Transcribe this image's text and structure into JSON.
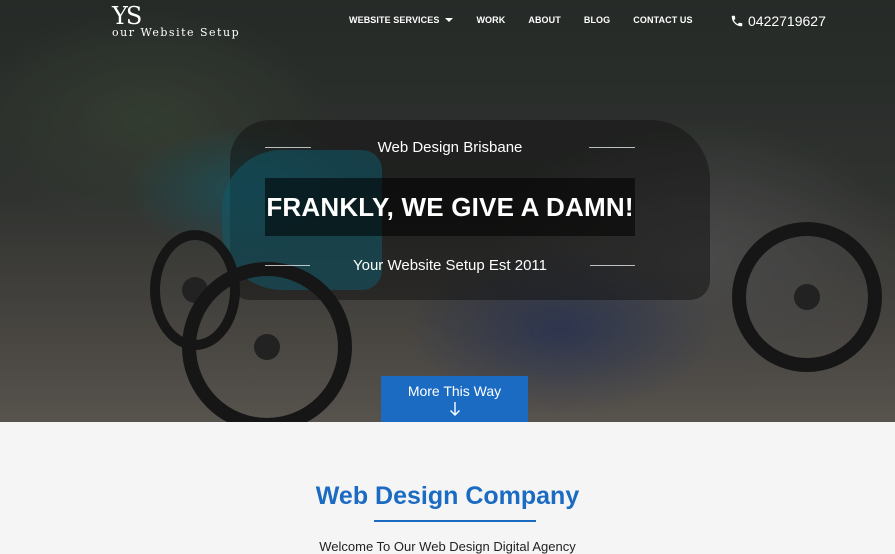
{
  "logo": {
    "mark": "YS",
    "text": "our Website Setup"
  },
  "nav": {
    "items": [
      {
        "label": "WEBSITE SERVICES",
        "has_dropdown": true
      },
      {
        "label": "WORK"
      },
      {
        "label": "ABOUT"
      },
      {
        "label": "BLOG"
      },
      {
        "label": "CONTACT US"
      }
    ],
    "phone": "0422719627"
  },
  "hero": {
    "subtitle_top": "Web Design Brisbane",
    "headline": "FRANKLY, WE GIVE A DAMN!",
    "subtitle_bottom": "Your Website Setup Est 2011",
    "cta_label": "More This Way"
  },
  "content": {
    "section_title": "Web Design Company",
    "welcome": "Welcome To Our Web Design Digital Agency"
  },
  "colors": {
    "accent": "#1b6bc3",
    "background": "#f5f5f5"
  },
  "icons": {
    "phone": "phone-icon",
    "arrow": "arrow-down-icon",
    "caret": "chevron-down-icon"
  }
}
